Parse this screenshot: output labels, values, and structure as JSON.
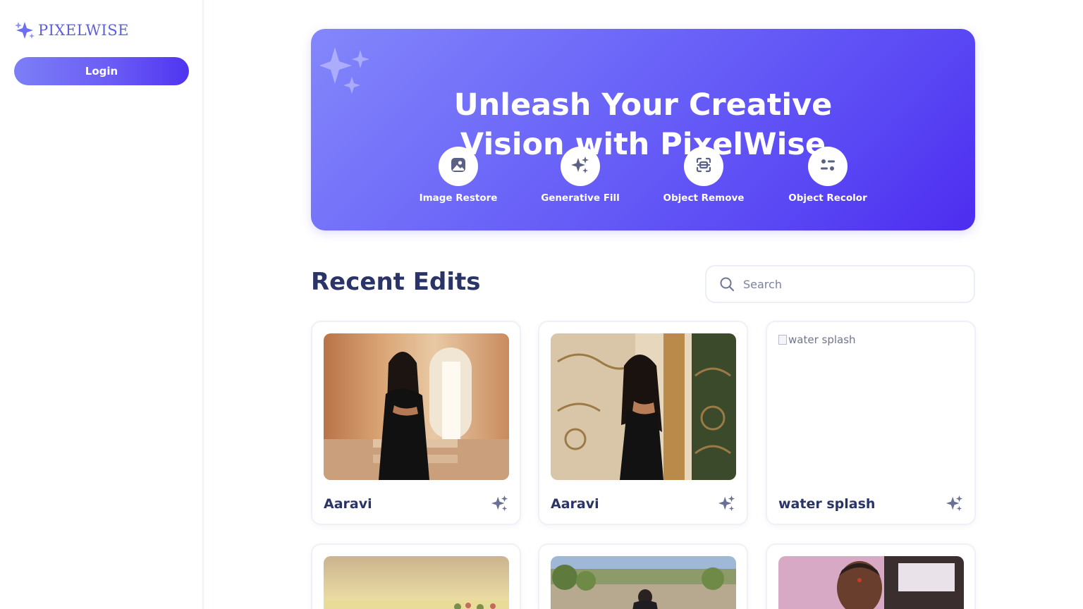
{
  "sidebar": {
    "logo_text": "PIXELWISE",
    "login_label": "Login"
  },
  "hero": {
    "title_line1": "Unleash Your Creative",
    "title_line2": "Vision with PixelWise",
    "features": [
      {
        "label": "Image Restore",
        "icon": "image-restore-icon"
      },
      {
        "label": "Generative Fill",
        "icon": "sparkles-icon"
      },
      {
        "label": "Object Remove",
        "icon": "object-remove-icon"
      },
      {
        "label": "Object Recolor",
        "icon": "object-recolor-icon"
      }
    ]
  },
  "recent": {
    "title": "Recent Edits",
    "search_placeholder": "Search",
    "cards": [
      {
        "name": "Aaravi",
        "image": "photo"
      },
      {
        "name": "Aaravi",
        "image": "photo"
      },
      {
        "name": "water splash",
        "image": "broken",
        "alt": "water splash"
      },
      {
        "name": "",
        "image": "photo"
      },
      {
        "name": "",
        "image": "photo"
      },
      {
        "name": "",
        "image": "photo"
      }
    ]
  },
  "colors": {
    "brand": "#5b5fe0",
    "heading": "#2a3467",
    "hero_start": "#8387fb",
    "hero_end": "#4d2cf0"
  }
}
